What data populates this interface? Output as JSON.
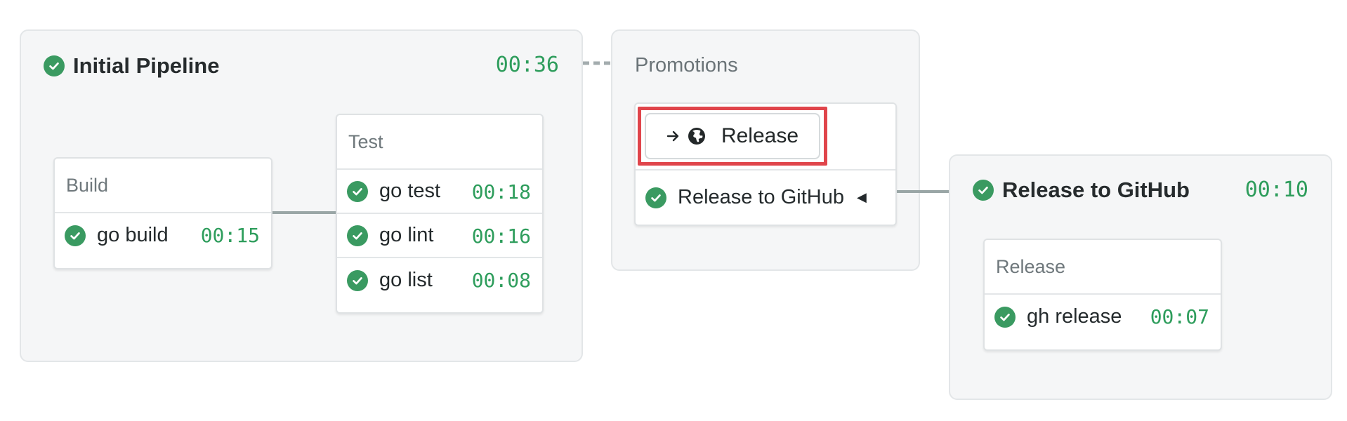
{
  "initial_pipeline": {
    "title": "Initial Pipeline",
    "duration": "00:36",
    "blocks": [
      {
        "name": "Build",
        "jobs": [
          {
            "name": "go build",
            "duration": "00:15"
          }
        ]
      },
      {
        "name": "Test",
        "jobs": [
          {
            "name": "go test",
            "duration": "00:18"
          },
          {
            "name": "go lint",
            "duration": "00:16"
          },
          {
            "name": "go list",
            "duration": "00:08"
          }
        ]
      }
    ]
  },
  "promotions": {
    "title": "Promotions",
    "button_label": "Release",
    "items": [
      {
        "name": "Release to GitHub",
        "marker": "◀"
      }
    ]
  },
  "release_pipeline": {
    "title": "Release to GitHub",
    "duration": "00:10",
    "blocks": [
      {
        "name": "Release",
        "jobs": [
          {
            "name": "gh release",
            "duration": "00:07"
          }
        ]
      }
    ]
  },
  "colors": {
    "success": "#3a9a61",
    "duration_text": "#2e9d5c",
    "highlight": "#e0454b",
    "panel_bg": "#f5f6f7"
  },
  "icons": {
    "status": "check-circle-icon",
    "promote_arrow": "arrow-right-icon",
    "globe": "globe-icon",
    "active_marker": "triangle-left-icon"
  }
}
